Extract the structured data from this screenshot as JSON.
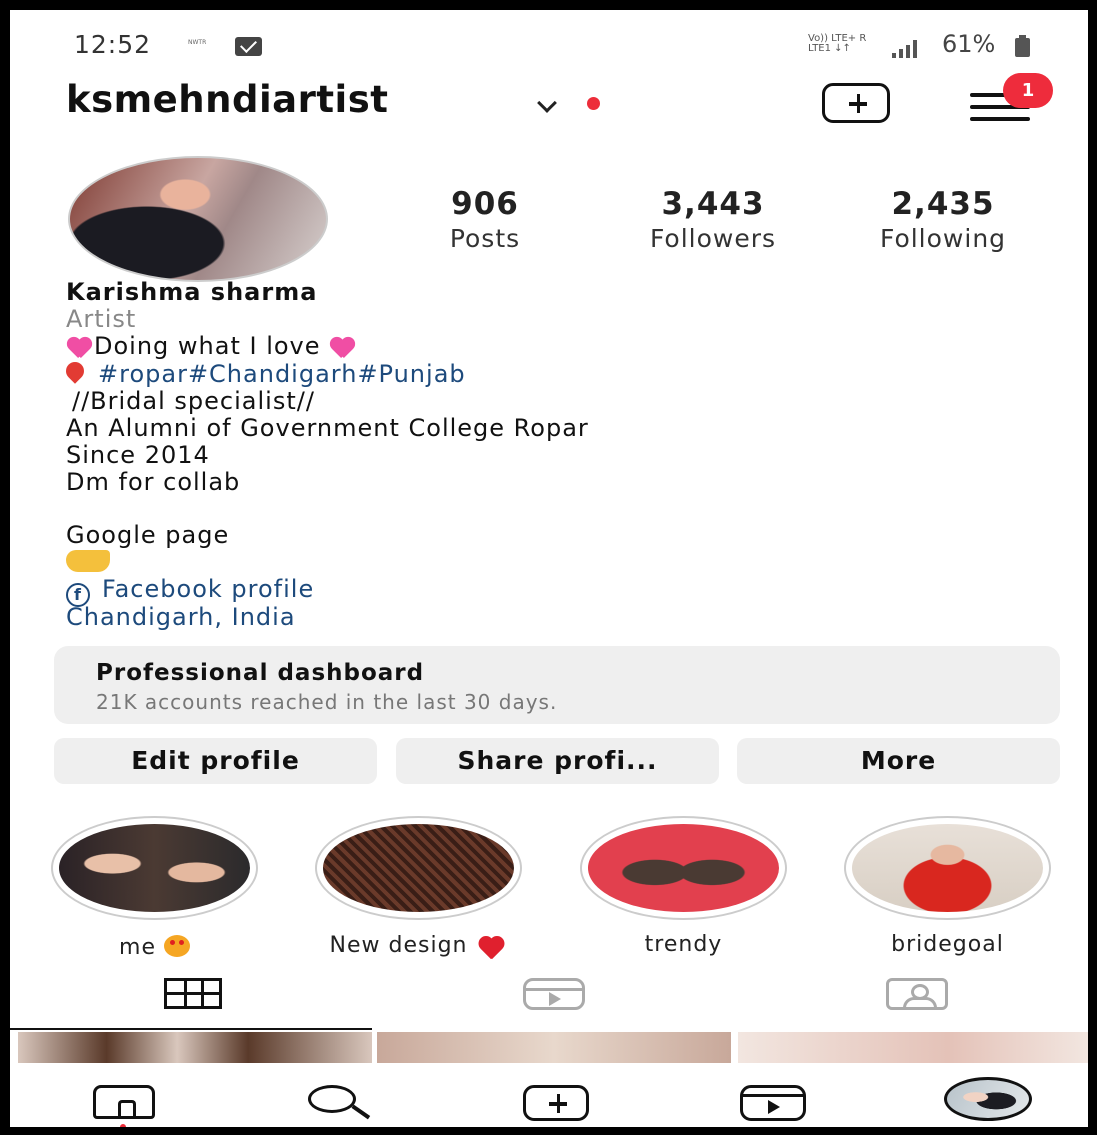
{
  "status_bar": {
    "time": "12:52",
    "carrier_badge": "NWTR",
    "network_text": "Vo)) LTE+ R\nLTE1 ↓↑",
    "battery": "61%"
  },
  "header": {
    "username": "ksmehndiartist",
    "notification_count": "1"
  },
  "stats": [
    {
      "value": "906",
      "label": "Posts"
    },
    {
      "value": "3,443",
      "label": "Followers"
    },
    {
      "value": "2,435",
      "label": "Following"
    }
  ],
  "bio": {
    "name": "Karishma sharma",
    "category": "Artist",
    "line1": "Doing what I love",
    "hashtags": "#ropar#Chandigarh#Punjab",
    "line3": "//Bridal specialist//",
    "line4": "An Alumni of Government College Ropar",
    "line5": "Since 2014",
    "line6": "Dm for collab",
    "line7": "Google page",
    "facebook_link": "Facebook profile",
    "location": "Chandigarh, India"
  },
  "dashboard": {
    "title": "Professional dashboard",
    "subtitle": "21K accounts reached in the last 30 days."
  },
  "buttons": {
    "edit": "Edit profile",
    "share": "Share profi...",
    "more": "More"
  },
  "highlights": [
    {
      "label": "me"
    },
    {
      "label": "New design"
    },
    {
      "label": "trendy"
    },
    {
      "label": "bridegoal"
    }
  ],
  "icons": {
    "create": "plus-square-icon",
    "menu": "hamburger-icon",
    "grid": "grid-icon",
    "reels": "reels-icon",
    "tagged": "tagged-icon",
    "home": "home-icon",
    "search": "search-icon",
    "add": "add-icon",
    "reel_nav": "reels-icon",
    "profile": "avatar"
  },
  "colors": {
    "accent_red": "#ed2d3a",
    "link_blue": "#1d4a7c",
    "button_bg": "#efefef"
  }
}
